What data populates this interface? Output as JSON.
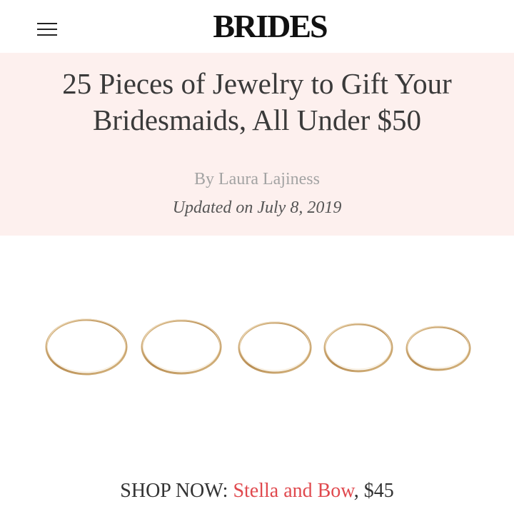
{
  "header": {
    "logo": "BRIDES",
    "menu_icon": "hamburger-menu-icon"
  },
  "article": {
    "headline": "25 Pieces of Jewelry to Gift Your Bridesmaids, All Under $50",
    "byline": "By Laura Lajiness",
    "updated": "Updated on July 8, 2019",
    "hero_background": "#fdf0ee"
  },
  "product": {
    "image_subject": "five thin gold stacking rings",
    "ring_color": "#c9a46a",
    "shop_prefix": "SHOP NOW:",
    "retailer": "Stella and Bow",
    "separator": ",",
    "price": "$45",
    "link_color": "#e0494e"
  }
}
